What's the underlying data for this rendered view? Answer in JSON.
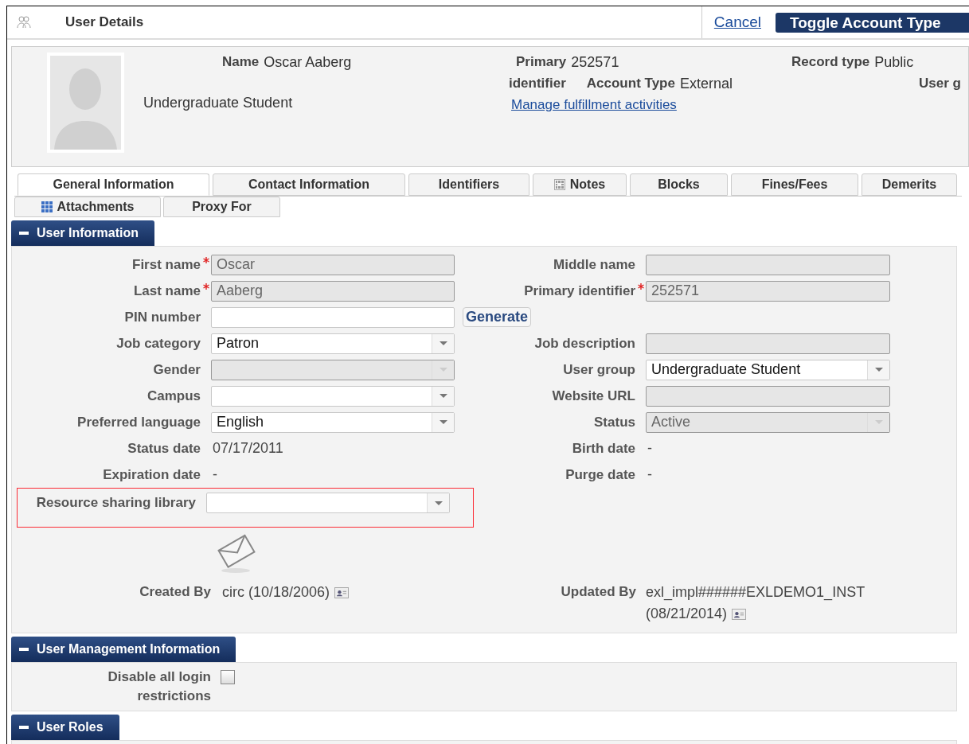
{
  "header": {
    "title": "User Details",
    "cancel": "Cancel",
    "toggle": "Toggle Account Type"
  },
  "profile": {
    "name_label": "Name",
    "name": "Oscar Aaberg",
    "group": "Undergraduate Student",
    "primary_label_1": "Primary",
    "primary_label_2": "identifier",
    "primary": "252571",
    "account_type_label": "Account Type",
    "account_type": "External",
    "link": "Manage fulfillment activities",
    "record_type_label": "Record type",
    "record_type": "Public",
    "user_group_label": "User g"
  },
  "tab_rows": [
    [
      {
        "label": "General Information",
        "selected": true
      },
      {
        "label": "Contact Information",
        "selected": false
      },
      {
        "label": "Identifiers",
        "selected": false
      },
      {
        "label": "Notes",
        "selected": false
      },
      {
        "label": "Blocks",
        "selected": false
      },
      {
        "label": "Fines/Fees",
        "selected": false
      },
      {
        "label": "Demerits",
        "selected": false
      }
    ],
    [
      {
        "label": "Attachments",
        "selected": false
      },
      {
        "label": "Proxy For",
        "selected": false
      }
    ]
  ],
  "user_information": {
    "title": "User Information",
    "expanded": true,
    "rows": [
      {
        "left": {
          "label": "First name",
          "kind": "text",
          "value": "Oscar",
          "required": true,
          "disabled": true,
          "highlighted": false
        },
        "right": {
          "label": "Middle name",
          "kind": "text",
          "required": false,
          "disabled": true
        }
      },
      {
        "left": {
          "label": "Last name",
          "kind": "text",
          "value": "Aaberg",
          "required": true,
          "disabled": true,
          "highlighted": false
        },
        "right": {
          "label": "Primary identifier",
          "kind": "text",
          "value": "252571",
          "required": true,
          "disabled": true
        }
      },
      {
        "left": {
          "label": "PIN number",
          "kind": "text",
          "required": false,
          "disabled": false,
          "highlighted": false
        },
        "button": "Generate"
      },
      {
        "left": {
          "label": "Job category",
          "kind": "select",
          "value": "Patron",
          "required": false,
          "disabled": false,
          "highlighted": false
        },
        "right": {
          "label": "Job description",
          "kind": "text",
          "required": false,
          "disabled": true
        }
      },
      {
        "left": {
          "label": "Gender",
          "kind": "select",
          "required": false,
          "disabled": true,
          "highlighted": false
        },
        "right": {
          "label": "User group",
          "kind": "select",
          "value": "Undergraduate Student",
          "required": false,
          "disabled": false
        }
      },
      {
        "left": {
          "label": "Campus",
          "kind": "select",
          "required": false,
          "disabled": false,
          "highlighted": false
        },
        "right": {
          "label": "Website URL",
          "kind": "text",
          "required": false,
          "disabled": true
        }
      },
      {
        "left": {
          "label": "Preferred language",
          "kind": "select",
          "value": "English",
          "required": false,
          "disabled": false,
          "highlighted": false
        },
        "right": {
          "label": "Status",
          "kind": "select",
          "value": "Active",
          "required": false,
          "disabled": true
        }
      },
      {
        "left": {
          "label": "Status date",
          "kind": "value",
          "value": "07/17/2011",
          "highlighted": false
        },
        "right": {
          "label": "Birth date",
          "kind": "value",
          "value": "-"
        }
      },
      {
        "left": {
          "label": "Expiration date",
          "kind": "value",
          "value": "-",
          "highlighted": false
        },
        "right": {
          "label": "Purge date",
          "kind": "value",
          "value": "-"
        }
      },
      {
        "left": {
          "label": "Resource sharing library",
          "kind": "select",
          "required": false,
          "disabled": false,
          "highlighted": true
        }
      }
    ],
    "created_label": "Created By",
    "created": "circ (10/18/2006)",
    "updated_label": "Updated By",
    "updated_lines": [
      "exl_impl######EXLDEMO1_INST",
      "(08/21/2014)"
    ]
  },
  "user_management": {
    "title": "User Management Information",
    "expanded": true,
    "disable_login_label": "Disable all login restrictions",
    "disable_login_checked": false
  },
  "user_roles": {
    "title": "User Roles",
    "expanded": true
  }
}
